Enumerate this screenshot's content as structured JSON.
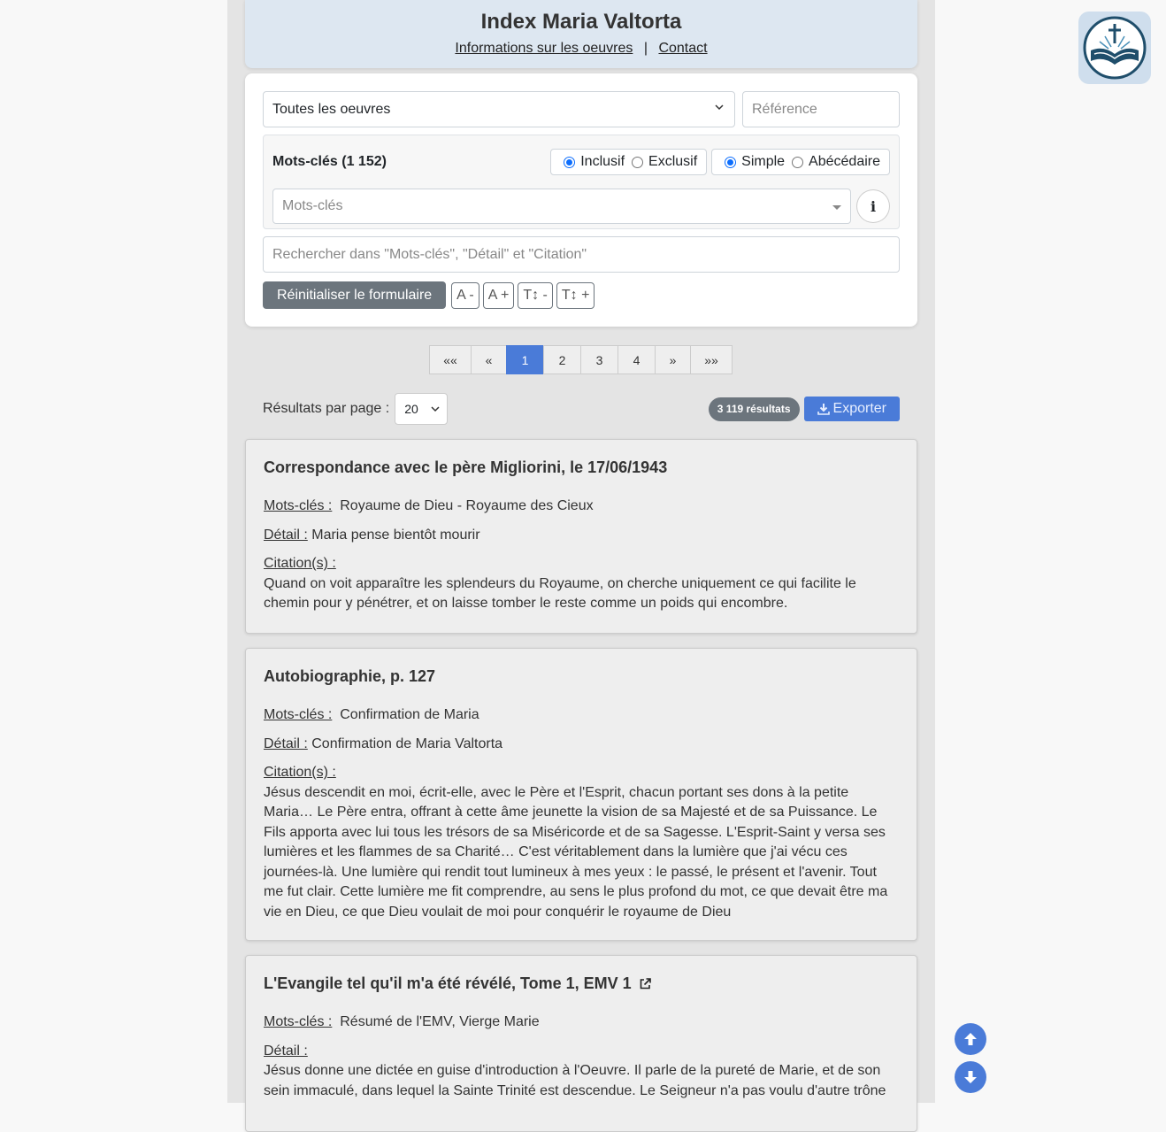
{
  "header": {
    "title": "Index Maria Valtorta",
    "link_info": "Informations sur les oeuvres",
    "separator": "|",
    "link_contact": "Contact"
  },
  "form": {
    "oeuvres_selected": "Toutes les oeuvres",
    "reference_placeholder": "Référence",
    "keywords_title": "Mots-clés (1 152)",
    "mode_options": [
      {
        "label": "Inclusif",
        "checked": true
      },
      {
        "label": "Exclusif",
        "checked": false
      }
    ],
    "order_options": [
      {
        "label": "Simple",
        "checked": true
      },
      {
        "label": "Abécédaire",
        "checked": false
      }
    ],
    "keywords_placeholder": "Mots-clés",
    "info_label": "i",
    "search_placeholder": "Rechercher dans \"Mots-clés\", \"Détail\" et \"Citation\"",
    "reset_label": "Réinitialiser le formulaire",
    "size_buttons": [
      "A -",
      "A +",
      "T↕ -",
      "T↕ +"
    ]
  },
  "pagination": {
    "items": [
      "««",
      "«",
      "1",
      "2",
      "3",
      "4",
      "»",
      "»»"
    ],
    "active": "1"
  },
  "results_bar": {
    "per_page_label": "Résultats par page :",
    "per_page_value": "20",
    "count_badge": "3 119 résultats",
    "export_label": "Exporter"
  },
  "labels": {
    "keywords": "Mots-clés :",
    "detail": "Détail :",
    "citation": "Citation(s) :"
  },
  "results": [
    {
      "title": "Correspondance avec le père Migliorini, le 17/06/1943",
      "keywords": "Royaume de Dieu - Royaume des Cieux",
      "detail": "Maria pense bientôt mourir",
      "citation": "Quand on voit apparaître les splendeurs du Royaume, on cherche uniquement ce qui facilite le chemin pour y pénétrer, et on laisse tomber le reste comme un poids qui encombre."
    },
    {
      "title": "Autobiographie, p. 127",
      "keywords": "Confirmation de Maria",
      "detail": "Confirmation de Maria Valtorta",
      "citation": "Jésus descendit en moi, écrit-elle, avec le Père et l'Esprit, chacun portant ses dons à la petite Maria… Le Père entra, offrant à cette âme jeunette la vision de sa Majesté et de sa Puissance. Le Fils apporta avec lui tous les trésors de sa Miséricorde et de sa Sagesse. L'Esprit-Saint y versa ses lumières et les flammes de sa Charité… C'est véritablement dans la lumière que j'ai vécu ces journées-là. Une lumière qui rendit tout lumineux à mes yeux : le passé, le présent et l'avenir. Tout me fut clair. Cette lumière me fit comprendre, au sens le plus profond du mot, ce que devait être ma vie en Dieu, ce que Dieu voulait de moi pour conquérir le royaume de Dieu"
    },
    {
      "title": "L'Evangile tel qu'il m'a été révélé, Tome 1, EMV 1",
      "keywords": "Résumé de l'EMV, Vierge Marie",
      "detail_text": "Jésus donne une dictée en guise d'introduction à l'Oeuvre. Il parle de la pureté de Marie, et de son sein immaculé, dans lequel la Sainte Trinité est descendue. Le Seigneur n'a pas voulu d'autre trône"
    }
  ],
  "colors": {
    "accent": "#4a7bd8",
    "header_bg": "#dde7f1",
    "page_bg": "#e4e4e4",
    "secondary": "#6c757d"
  },
  "icons": [
    "chevron-down-icon",
    "external-link-icon",
    "download-icon",
    "bible-cross-logo",
    "arrow-up-icon",
    "arrow-down-icon"
  ]
}
